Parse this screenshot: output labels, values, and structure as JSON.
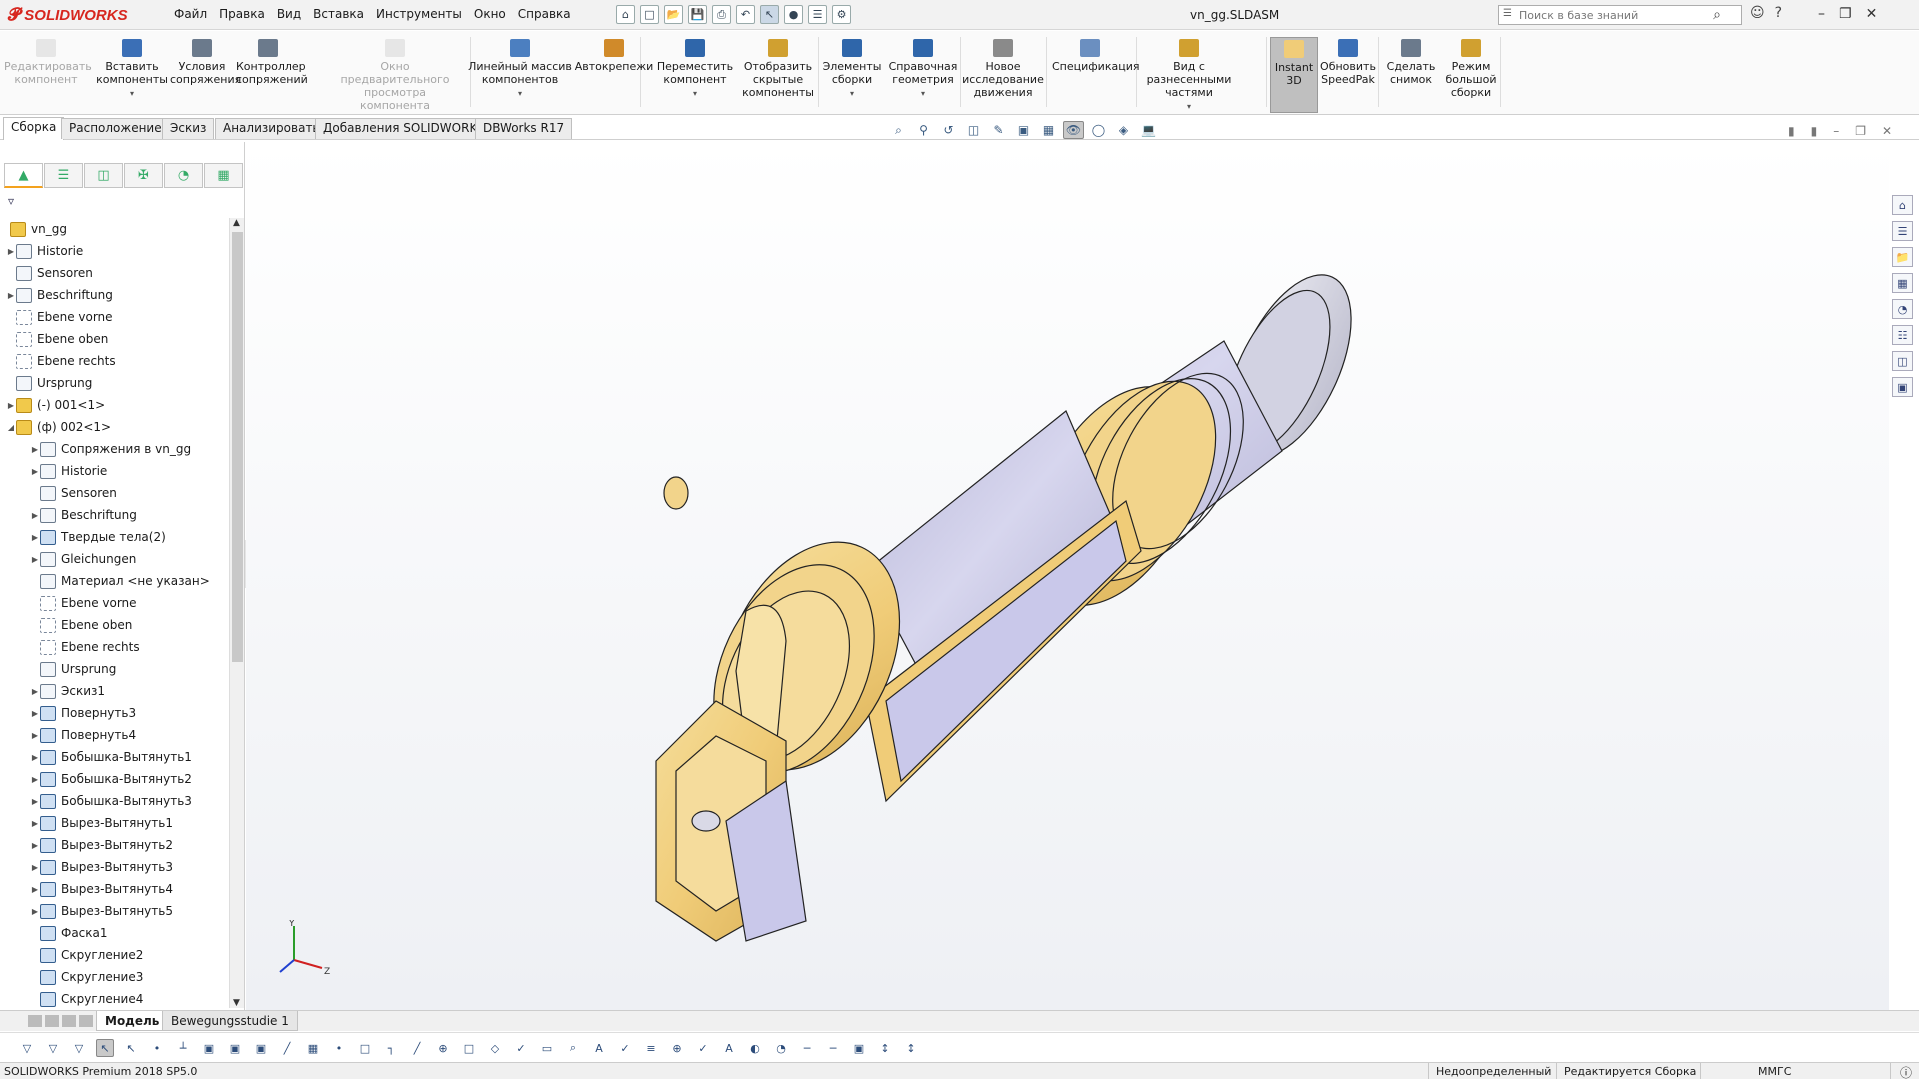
{
  "app": {
    "brand": "SOLIDWORKS",
    "document_title": "vn_gg.SLDASM",
    "search_placeholder": "Поиск в базе знаний",
    "accent_color": "#d7261e"
  },
  "menu": [
    "Файл",
    "Правка",
    "Вид",
    "Вставка",
    "Инструменты",
    "Окно",
    "Справка"
  ],
  "quick_access_icons": [
    "home-icon",
    "new-document-icon",
    "open-folder-icon",
    "save-icon",
    "print-icon",
    "undo-icon",
    "select-arrow-icon",
    "traffic-light-icon",
    "file-properties-icon",
    "options-gear-icon"
  ],
  "ribbon": {
    "buttons": [
      {
        "label": "Редактировать компонент",
        "enabled": false,
        "icon": "edit-component-icon"
      },
      {
        "label": "Вставить компоненты",
        "enabled": true,
        "dropdown": true,
        "icon": "insert-components-icon"
      },
      {
        "label": "Условия сопряжения",
        "enabled": true,
        "icon": "mate-icon"
      },
      {
        "label": "Контроллер сопряжений",
        "enabled": true,
        "icon": "mate-controller-icon"
      },
      {
        "label": "Окно предварительного просмотра компонента",
        "enabled": false,
        "icon": "component-preview-icon"
      },
      {
        "label": "Линейный массив компонентов",
        "enabled": true,
        "dropdown": true,
        "icon": "linear-pattern-icon"
      },
      {
        "label": "Автокрепежи",
        "enabled": true,
        "icon": "smart-fasteners-icon"
      },
      {
        "label": "Переместить компонент",
        "enabled": true,
        "dropdown": true,
        "icon": "move-component-icon"
      },
      {
        "label": "Отобразить скрытые компоненты",
        "enabled": true,
        "icon": "show-hidden-icon"
      },
      {
        "label": "Элементы сборки",
        "enabled": true,
        "dropdown": true,
        "icon": "assembly-features-icon"
      },
      {
        "label": "Справочная геометрия",
        "enabled": true,
        "dropdown": true,
        "icon": "reference-geometry-icon"
      },
      {
        "label": "Новое исследование движения",
        "enabled": true,
        "icon": "motion-study-icon"
      },
      {
        "label": "Спецификация",
        "enabled": true,
        "icon": "bom-icon"
      },
      {
        "label": "Вид с разнесенными частями",
        "enabled": true,
        "dropdown": true,
        "icon": "exploded-view-icon"
      },
      {
        "label": "Instant 3D",
        "enabled": true,
        "active": true,
        "icon": "instant3d-icon"
      },
      {
        "label": "Обновить SpeedPak",
        "enabled": true,
        "icon": "speedpak-icon"
      },
      {
        "label": "Сделать снимок",
        "enabled": true,
        "icon": "snapshot-icon"
      },
      {
        "label": "Режим большой сборки",
        "enabled": true,
        "icon": "large-assembly-icon"
      }
    ]
  },
  "command_tabs": [
    "Сборка",
    "Расположение",
    "Эскиз",
    "Анализировать",
    "Добавления SOLIDWORKS",
    "DBWorks R17"
  ],
  "active_command_tab": "Сборка",
  "feature_tree": {
    "root": "vn_gg",
    "items": [
      {
        "label": "Historie",
        "level": 1,
        "expandable": true,
        "icon": "history-icon"
      },
      {
        "label": "Sensoren",
        "level": 1,
        "expandable": false,
        "icon": "sensor-icon"
      },
      {
        "label": "Beschriftung",
        "level": 1,
        "expandable": true,
        "icon": "annotation-icon"
      },
      {
        "label": "Ebene vorne",
        "level": 1,
        "expandable": false,
        "icon": "plane-icon"
      },
      {
        "label": "Ebene oben",
        "level": 1,
        "expandable": false,
        "icon": "plane-icon"
      },
      {
        "label": "Ebene rechts",
        "level": 1,
        "expandable": false,
        "icon": "plane-icon"
      },
      {
        "label": "Ursprung",
        "level": 1,
        "expandable": false,
        "icon": "origin-icon"
      },
      {
        "label": "(-) 001<1>",
        "level": 1,
        "expandable": true,
        "icon": "part-icon"
      },
      {
        "label": "(ф) 002<1>",
        "level": 1,
        "expandable": true,
        "expanded": true,
        "icon": "part-icon"
      },
      {
        "label": "Сопряжения в vn_gg",
        "level": 2,
        "expandable": true,
        "icon": "mates-folder-icon"
      },
      {
        "label": "Historie",
        "level": 2,
        "expandable": true,
        "icon": "history-icon"
      },
      {
        "label": "Sensoren",
        "level": 2,
        "expandable": false,
        "icon": "sensor-icon"
      },
      {
        "label": "Beschriftung",
        "level": 2,
        "expandable": true,
        "icon": "annotation-icon"
      },
      {
        "label": "Твердые тела(2)",
        "level": 2,
        "expandable": true,
        "icon": "solid-bodies-icon"
      },
      {
        "label": "Gleichungen",
        "level": 2,
        "expandable": true,
        "icon": "equations-icon"
      },
      {
        "label": "Материал <не указан>",
        "level": 2,
        "expandable": false,
        "icon": "material-icon"
      },
      {
        "label": "Ebene vorne",
        "level": 2,
        "expandable": false,
        "icon": "plane-icon"
      },
      {
        "label": "Ebene oben",
        "level": 2,
        "expandable": false,
        "icon": "plane-icon"
      },
      {
        "label": "Ebene rechts",
        "level": 2,
        "expandable": false,
        "icon": "plane-icon"
      },
      {
        "label": "Ursprung",
        "level": 2,
        "expandable": false,
        "icon": "origin-icon"
      },
      {
        "label": "Эскиз1",
        "level": 2,
        "expandable": true,
        "icon": "sketch-icon"
      },
      {
        "label": "Повернуть3",
        "level": 2,
        "expandable": true,
        "icon": "revolve-icon"
      },
      {
        "label": "Повернуть4",
        "level": 2,
        "expandable": true,
        "icon": "revolve-icon"
      },
      {
        "label": "Бобышка-Вытянуть1",
        "level": 2,
        "expandable": true,
        "icon": "extrude-boss-icon"
      },
      {
        "label": "Бобышка-Вытянуть2",
        "level": 2,
        "expandable": true,
        "icon": "extrude-boss-icon"
      },
      {
        "label": "Бобышка-Вытянуть3",
        "level": 2,
        "expandable": true,
        "icon": "extrude-boss-icon"
      },
      {
        "label": "Вырез-Вытянуть1",
        "level": 2,
        "expandable": true,
        "icon": "extrude-cut-icon"
      },
      {
        "label": "Вырез-Вытянуть2",
        "level": 2,
        "expandable": true,
        "icon": "extrude-cut-icon"
      },
      {
        "label": "Вырез-Вытянуть3",
        "level": 2,
        "expandable": true,
        "icon": "extrude-cut-icon"
      },
      {
        "label": "Вырез-Вытянуть4",
        "level": 2,
        "expandable": true,
        "icon": "extrude-cut-icon"
      },
      {
        "label": "Вырез-Вытянуть5",
        "level": 2,
        "expandable": true,
        "icon": "extrude-cut-icon"
      },
      {
        "label": "Фаска1",
        "level": 2,
        "expandable": false,
        "icon": "chamfer-icon"
      },
      {
        "label": "Скругление2",
        "level": 2,
        "expandable": false,
        "icon": "fillet-icon"
      },
      {
        "label": "Скругление3",
        "level": 2,
        "expandable": false,
        "icon": "fillet-icon"
      },
      {
        "label": "Скругление4",
        "level": 2,
        "expandable": false,
        "icon": "fillet-icon"
      }
    ]
  },
  "bottom_tabs": [
    "Модель",
    "Bewegungsstudie 1"
  ],
  "active_bottom_tab": "Модель",
  "status_bar": {
    "product": "SOLIDWORKS Premium 2018 SP5.0",
    "definition": "Недоопределенный",
    "mode": "Редактируется Сборка",
    "units": "ММГС"
  },
  "model_colors": {
    "gold": "#f2d48b",
    "gold_dark": "#c9a24a",
    "lavender": "#c9c8ea",
    "silver": "#d9d9e6"
  }
}
